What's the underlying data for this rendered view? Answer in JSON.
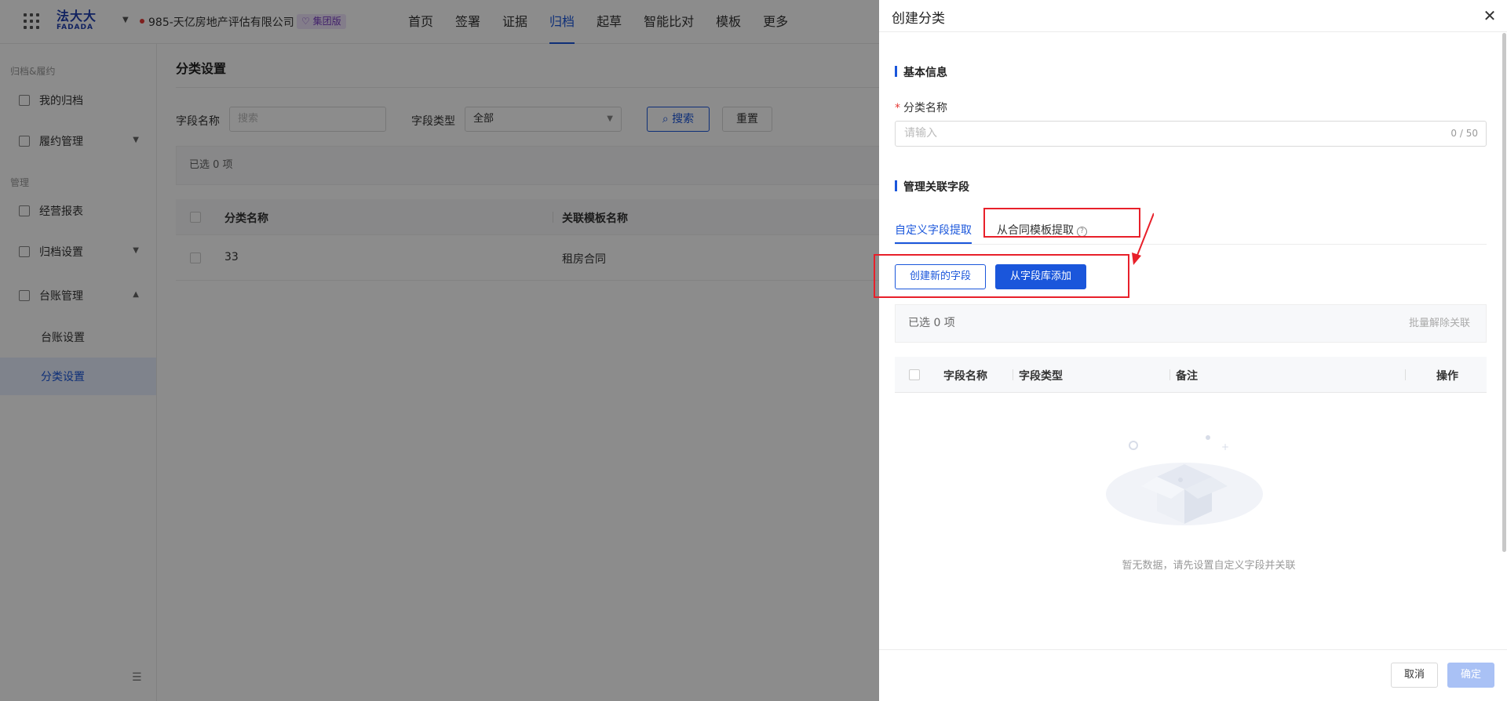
{
  "topbar": {
    "logo_main": "法大大",
    "logo_sub": "FADADA",
    "org_name": "985-天亿房地产评估有限公司",
    "org_badge": "集团版",
    "nav": [
      "首页",
      "签署",
      "证据",
      "归档",
      "起草",
      "智能比对",
      "模板",
      "更多"
    ],
    "active_nav": "归档"
  },
  "sidebar": {
    "group1": "归档&履约",
    "my_archive": "我的归档",
    "fulfill_mgmt": "履约管理",
    "group2": "管理",
    "biz_report": "经营报表",
    "archive_settings": "归档设置",
    "ledger_mgmt": "台账管理",
    "ledger_settings": "台账设置",
    "category_settings": "分类设置"
  },
  "page": {
    "title": "分类设置",
    "field_name_label": "字段名称",
    "field_name_placeholder": "搜索",
    "field_type_label": "字段类型",
    "field_type_value": "全部",
    "search_btn": "搜索",
    "reset_btn": "重置",
    "selected_text": "已选 0 项",
    "columns": [
      "分类名称",
      "关联模板名称"
    ],
    "rows": [
      {
        "name": "33",
        "template": "租房合同"
      }
    ]
  },
  "drawer": {
    "title": "创建分类",
    "section_basic": "基本信息",
    "category_name_label": "分类名称",
    "category_name_placeholder": "请输入",
    "char_count": "0 / 50",
    "section_fields": "管理关联字段",
    "tab_custom": "自定义字段提取",
    "tab_template": "从合同模板提取",
    "btn_create_field": "创建新的字段",
    "btn_add_from_lib": "从字段库添加",
    "selected_text": "已选 0 项",
    "batch_unlink": "批量解除关联",
    "columns": [
      "字段名称",
      "字段类型",
      "备注",
      "操作"
    ],
    "empty_text": "暂无数据，请先设置自定义字段并关联",
    "cancel": "取消",
    "confirm": "确定"
  },
  "colors": {
    "primary": "#1a56db",
    "highlight": "#e8202a"
  }
}
